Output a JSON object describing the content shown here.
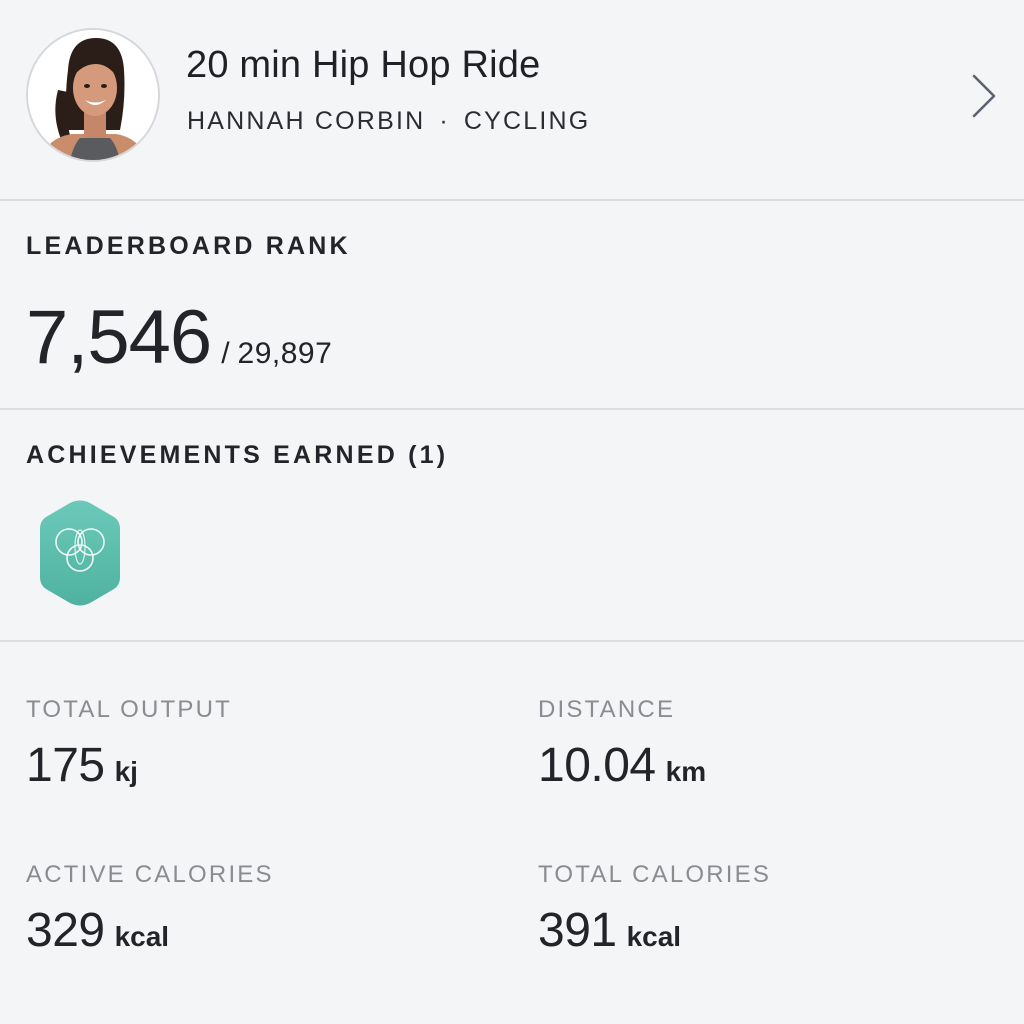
{
  "class": {
    "title": "20 min Hip Hop Ride",
    "instructor": "HANNAH CORBIN",
    "separator": "·",
    "discipline": "CYCLING",
    "avatar_icon": "instructor-photo",
    "chevron_icon": "chevron-right-icon"
  },
  "leaderboard": {
    "title": "LEADERBOARD RANK",
    "rank": "7,546",
    "separator": "/",
    "total": "29,897"
  },
  "achievements": {
    "title": "ACHIEVEMENTS EARNED (1)",
    "badges": [
      {
        "icon": "achievement-badge-icon",
        "color": "#5bbfae"
      }
    ]
  },
  "stats": {
    "total_output": {
      "label": "TOTAL OUTPUT",
      "value": "175",
      "unit": "kj"
    },
    "distance": {
      "label": "DISTANCE",
      "value": "10.04",
      "unit": "km"
    },
    "active_calories": {
      "label": "ACTIVE CALORIES",
      "value": "329",
      "unit": "kcal"
    },
    "total_calories": {
      "label": "TOTAL CALORIES",
      "value": "391",
      "unit": "kcal"
    }
  },
  "colors": {
    "background": "#f4f5f7",
    "divider": "#dcdde0",
    "text": "#222429",
    "label_gray": "#8a8c91",
    "badge_teal": "#5bbfae"
  }
}
